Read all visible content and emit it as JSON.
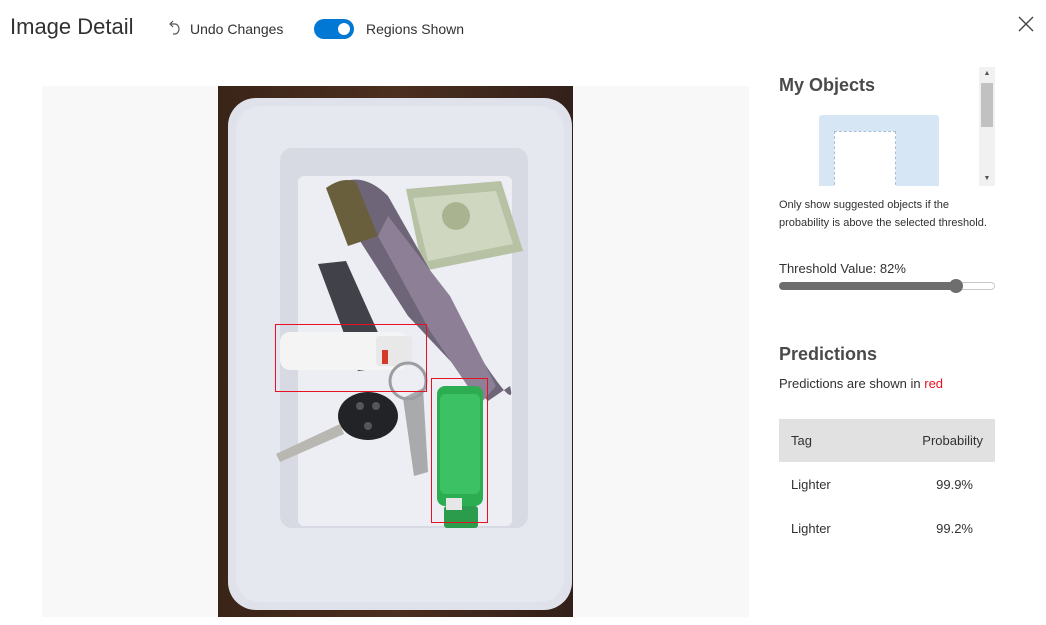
{
  "header": {
    "title": "Image Detail",
    "undo_label": "Undo Changes",
    "regions_toggle_label": "Regions Shown",
    "regions_toggle_on": true
  },
  "image": {
    "regions": [
      {
        "tag": "Lighter",
        "color": "#e81123"
      },
      {
        "tag": "Lighter",
        "color": "#e81123"
      }
    ]
  },
  "my_objects": {
    "title": "My Objects"
  },
  "threshold": {
    "hint": "Only show suggested objects if the probability is above the selected threshold.",
    "label": "Threshold Value: 82%",
    "value": 0.82
  },
  "predictions": {
    "title": "Predictions",
    "note_prefix": "Predictions are shown in ",
    "note_color_word": "red",
    "columns": [
      "Tag",
      "Probability"
    ],
    "rows": [
      {
        "tag": "Lighter",
        "probability": "99.9%"
      },
      {
        "tag": "Lighter",
        "probability": "99.2%"
      }
    ]
  },
  "colors": {
    "accent": "#0078d4",
    "region": "#e81123",
    "table_header": "#e1e1e1"
  }
}
